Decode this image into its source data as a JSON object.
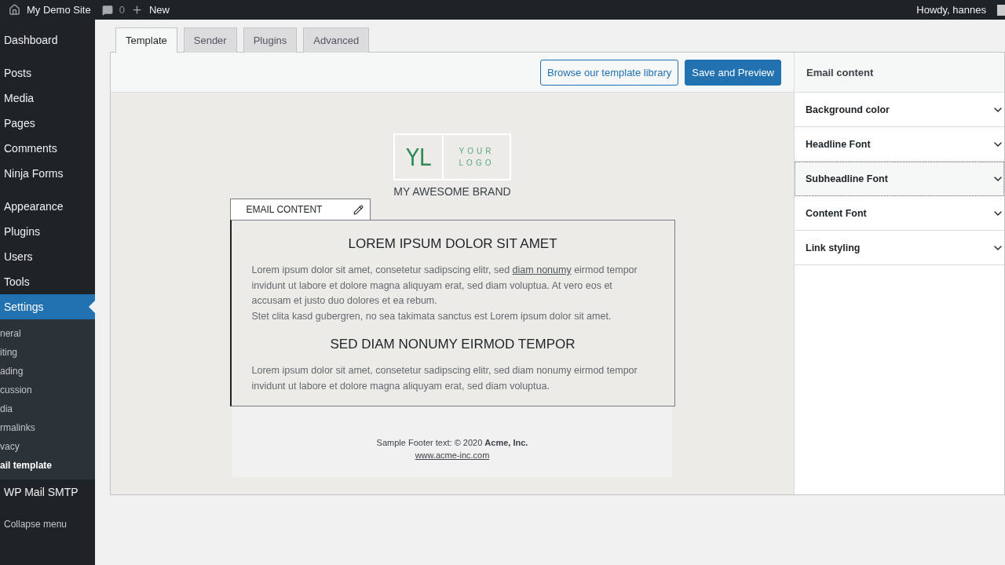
{
  "admin_bar": {
    "site": "My Demo Site",
    "comments": "0",
    "new": "New",
    "greeting": "Howdy, hannes"
  },
  "sidebar": {
    "groups": [
      {
        "items": [
          {
            "label": "Dashboard",
            "selected": false
          }
        ]
      },
      {
        "items": [
          {
            "label": "Posts",
            "selected": false
          },
          {
            "label": "Media",
            "selected": false
          },
          {
            "label": "Pages",
            "selected": false
          },
          {
            "label": "Comments",
            "selected": false
          },
          {
            "label": "Ninja Forms",
            "selected": false
          }
        ]
      },
      {
        "items": [
          {
            "label": "Appearance",
            "selected": false
          },
          {
            "label": "Plugins",
            "selected": false
          },
          {
            "label": "Users",
            "selected": false
          },
          {
            "label": "Tools",
            "selected": false
          },
          {
            "label": "Settings",
            "selected": true,
            "children": [
              {
                "label": "neral",
                "selected": false
              },
              {
                "label": "iting",
                "selected": false
              },
              {
                "label": "ading",
                "selected": false
              },
              {
                "label": "cussion",
                "selected": false
              },
              {
                "label": "dia",
                "selected": false
              },
              {
                "label": "rmalinks",
                "selected": false
              },
              {
                "label": "vacy",
                "selected": false
              },
              {
                "label": "ail template",
                "selected": true
              }
            ]
          },
          {
            "label": "WP Mail SMTP",
            "selected": false
          }
        ]
      }
    ],
    "collapse": "Collapse menu"
  },
  "tabs": [
    {
      "label": "Template",
      "selected": true
    },
    {
      "label": "Sender",
      "selected": false
    },
    {
      "label": "Plugins",
      "selected": false
    },
    {
      "label": "Advanced",
      "selected": false
    }
  ],
  "toolbar": {
    "browse": "Browse our template library",
    "save": "Save and Preview"
  },
  "email": {
    "logo_mark": "YL",
    "logo_text": [
      "YOUR",
      "LOGO"
    ],
    "brand": "MY AWESOME BRAND",
    "section_tab": "EMAIL CONTENT",
    "blocks": [
      {
        "kind": "heading",
        "text": "LOREM IPSUM DOLOR SIT AMET"
      },
      {
        "kind": "linked",
        "before": "Lorem ipsum dolor sit amet, consetetur sadipscing elitr, sed ",
        "link": "diam nonumy",
        "after": " eirmod tempor invidunt ut labore et dolore magna aliquyam erat, sed diam voluptua. At vero eos et accusam et justo duo dolores et ea rebum."
      },
      {
        "kind": "paragraph",
        "text": "Stet clita kasd gubergren, no sea takimata sanctus est Lorem ipsum dolor sit amet."
      },
      {
        "kind": "heading",
        "text": "SED DIAM NONUMY EIRMOD TEMPOR"
      },
      {
        "kind": "paragraph",
        "text": "Lorem ipsum dolor sit amet, consetetur sadipscing elitr, sed diam nonumy eirmod tempor invidunt ut labore et dolore magna aliquyam erat, sed diam voluptua."
      }
    ],
    "footer": "Sample Footer text: © 2020 **Acme, Inc.**",
    "footer_link": "www.acme-inc.com"
  },
  "panel": {
    "title": "Email content",
    "sections": [
      {
        "label": "Background color",
        "focused": false
      },
      {
        "label": "Headline Font",
        "focused": false
      },
      {
        "label": "Subheadline Font",
        "focused": true
      },
      {
        "label": "Content Font",
        "focused": false
      },
      {
        "label": "Link styling",
        "focused": false
      }
    ]
  }
}
